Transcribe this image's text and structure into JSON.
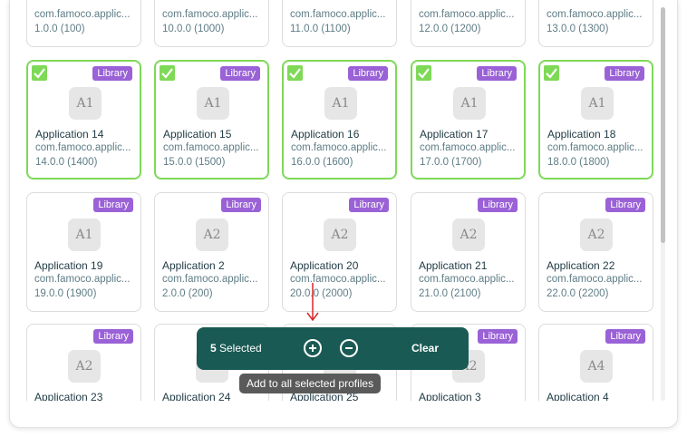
{
  "accent_colors": {
    "selected_border": "#7ed957",
    "badge": "#9a62d6",
    "action_bar": "#1a5a54",
    "tooltip": "#5a5a5a",
    "arrow": "#d9262a"
  },
  "rows": [
    {
      "cards": [
        {
          "name": "",
          "package": "com.famoco.applic...",
          "version": "1.0.0 (100)",
          "selected": false,
          "badge": "",
          "avatar": ""
        },
        {
          "name": "",
          "package": "com.famoco.applic...",
          "version": "10.0.0 (1000)",
          "selected": false,
          "badge": "",
          "avatar": ""
        },
        {
          "name": "",
          "package": "com.famoco.applic...",
          "version": "11.0.0 (1100)",
          "selected": false,
          "badge": "",
          "avatar": ""
        },
        {
          "name": "",
          "package": "com.famoco.applic...",
          "version": "12.0.0 (1200)",
          "selected": false,
          "badge": "",
          "avatar": ""
        },
        {
          "name": "",
          "package": "com.famoco.applic...",
          "version": "13.0.0 (1300)",
          "selected": false,
          "badge": "",
          "avatar": ""
        }
      ]
    },
    {
      "cards": [
        {
          "name": "Application 14",
          "package": "com.famoco.applic...",
          "version": "14.0.0 (1400)",
          "selected": true,
          "badge": "Library",
          "avatar": "A1"
        },
        {
          "name": "Application 15",
          "package": "com.famoco.applic...",
          "version": "15.0.0 (1500)",
          "selected": true,
          "badge": "Library",
          "avatar": "A1"
        },
        {
          "name": "Application 16",
          "package": "com.famoco.applic...",
          "version": "16.0.0 (1600)",
          "selected": true,
          "badge": "Library",
          "avatar": "A1"
        },
        {
          "name": "Application 17",
          "package": "com.famoco.applic...",
          "version": "17.0.0 (1700)",
          "selected": true,
          "badge": "Library",
          "avatar": "A1"
        },
        {
          "name": "Application 18",
          "package": "com.famoco.applic...",
          "version": "18.0.0 (1800)",
          "selected": true,
          "badge": "Library",
          "avatar": "A1"
        }
      ]
    },
    {
      "cards": [
        {
          "name": "Application 19",
          "package": "com.famoco.applic...",
          "version": "19.0.0 (1900)",
          "selected": false,
          "badge": "Library",
          "avatar": "A1"
        },
        {
          "name": "Application 2",
          "package": "com.famoco.applic...",
          "version": "2.0.0 (200)",
          "selected": false,
          "badge": "Library",
          "avatar": "A2"
        },
        {
          "name": "Application 20",
          "package": "com.famoco.applic...",
          "version": "20.0.0 (2000)",
          "selected": false,
          "badge": "Library",
          "avatar": "A2"
        },
        {
          "name": "Application 21",
          "package": "com.famoco.applic...",
          "version": "21.0.0 (2100)",
          "selected": false,
          "badge": "Library",
          "avatar": "A2"
        },
        {
          "name": "Application 22",
          "package": "com.famoco.applic...",
          "version": "22.0.0 (2200)",
          "selected": false,
          "badge": "Library",
          "avatar": "A2"
        }
      ]
    },
    {
      "cards": [
        {
          "name": "Application 23",
          "package": "",
          "version": "",
          "selected": false,
          "badge": "Library",
          "avatar": "A2"
        },
        {
          "name": "Application 24",
          "package": "",
          "version": "",
          "selected": false,
          "badge": "Library",
          "avatar": "A2"
        },
        {
          "name": "Application 25",
          "package": "",
          "version": "",
          "selected": false,
          "badge": "Library",
          "avatar": "A2"
        },
        {
          "name": "Application 3",
          "package": "",
          "version": "",
          "selected": false,
          "badge": "Library",
          "avatar": "A2"
        },
        {
          "name": "Application 4",
          "package": "",
          "version": "",
          "selected": false,
          "badge": "Library",
          "avatar": "A4"
        }
      ]
    }
  ],
  "action_bar": {
    "count": "5",
    "selected_label": "Selected",
    "add_icon": "plus-circle-icon",
    "remove_icon": "minus-circle-icon",
    "clear_label": "Clear"
  },
  "tooltip": {
    "text": "Add to all selected profiles"
  }
}
